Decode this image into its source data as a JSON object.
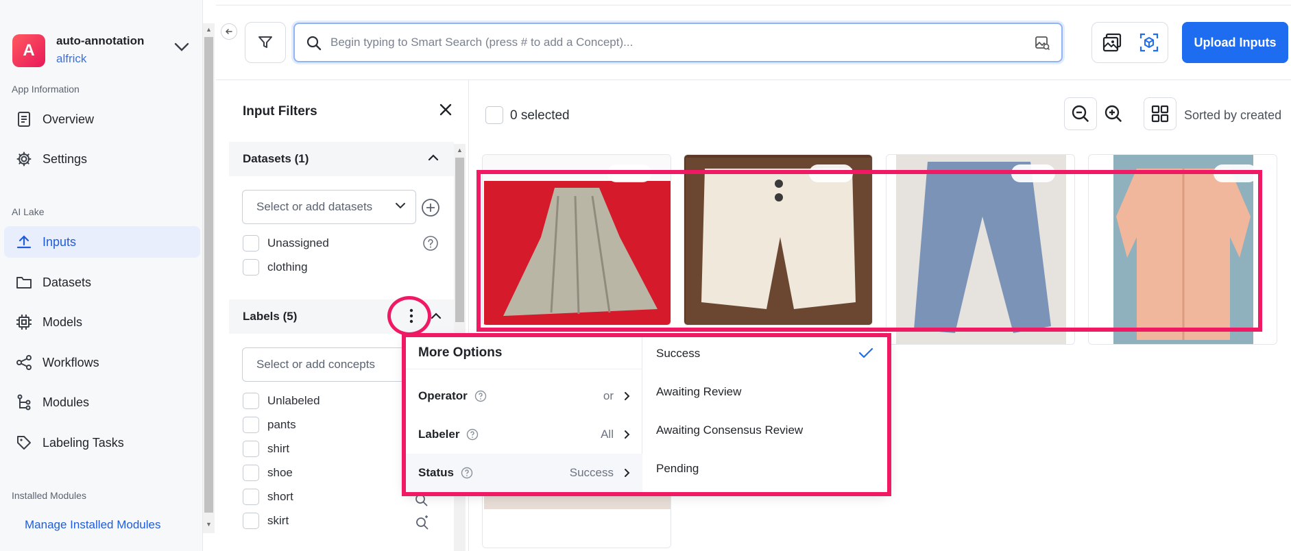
{
  "app": {
    "avatar_letter": "A",
    "name": "auto-annotation",
    "user": "alfrick"
  },
  "sidebar": {
    "section_app_info": "App Information",
    "overview": "Overview",
    "settings": "Settings",
    "section_ai_lake": "AI Lake",
    "inputs": "Inputs",
    "datasets": "Datasets",
    "models": "Models",
    "workflows": "Workflows",
    "modules": "Modules",
    "labeling_tasks": "Labeling Tasks",
    "section_installed": "Installed Modules",
    "manage_installed": "Manage Installed Modules"
  },
  "search": {
    "placeholder": "Begin typing to Smart Search (press # to add a Concept)..."
  },
  "toolbar": {
    "upload_label": "Upload Inputs"
  },
  "filters": {
    "title": "Input Filters",
    "datasets_header": "Datasets (1)",
    "datasets_placeholder": "Select or add datasets",
    "dataset_items": [
      "Unassigned",
      "clothing"
    ],
    "labels_header": "Labels (5)",
    "labels_placeholder": "Select or add concepts",
    "label_items": [
      "Unlabeled",
      "pants",
      "shirt",
      "shoe",
      "short",
      "skirt"
    ]
  },
  "content": {
    "selected_count": "0 selected",
    "sort_label": "Sorted by created"
  },
  "more_options": {
    "title": "More Options",
    "options": [
      {
        "name": "Operator",
        "value": "or"
      },
      {
        "name": "Labeler",
        "value": "All"
      },
      {
        "name": "Status",
        "value": "Success"
      }
    ],
    "status_values": [
      "Success",
      "Awaiting Review",
      "Awaiting Consensus Review",
      "Pending"
    ],
    "selected_status": "Success"
  },
  "colors": {
    "accent": "#1e6cf0",
    "highlight": "#f01a64",
    "active_nav": "#1e5cdc"
  }
}
